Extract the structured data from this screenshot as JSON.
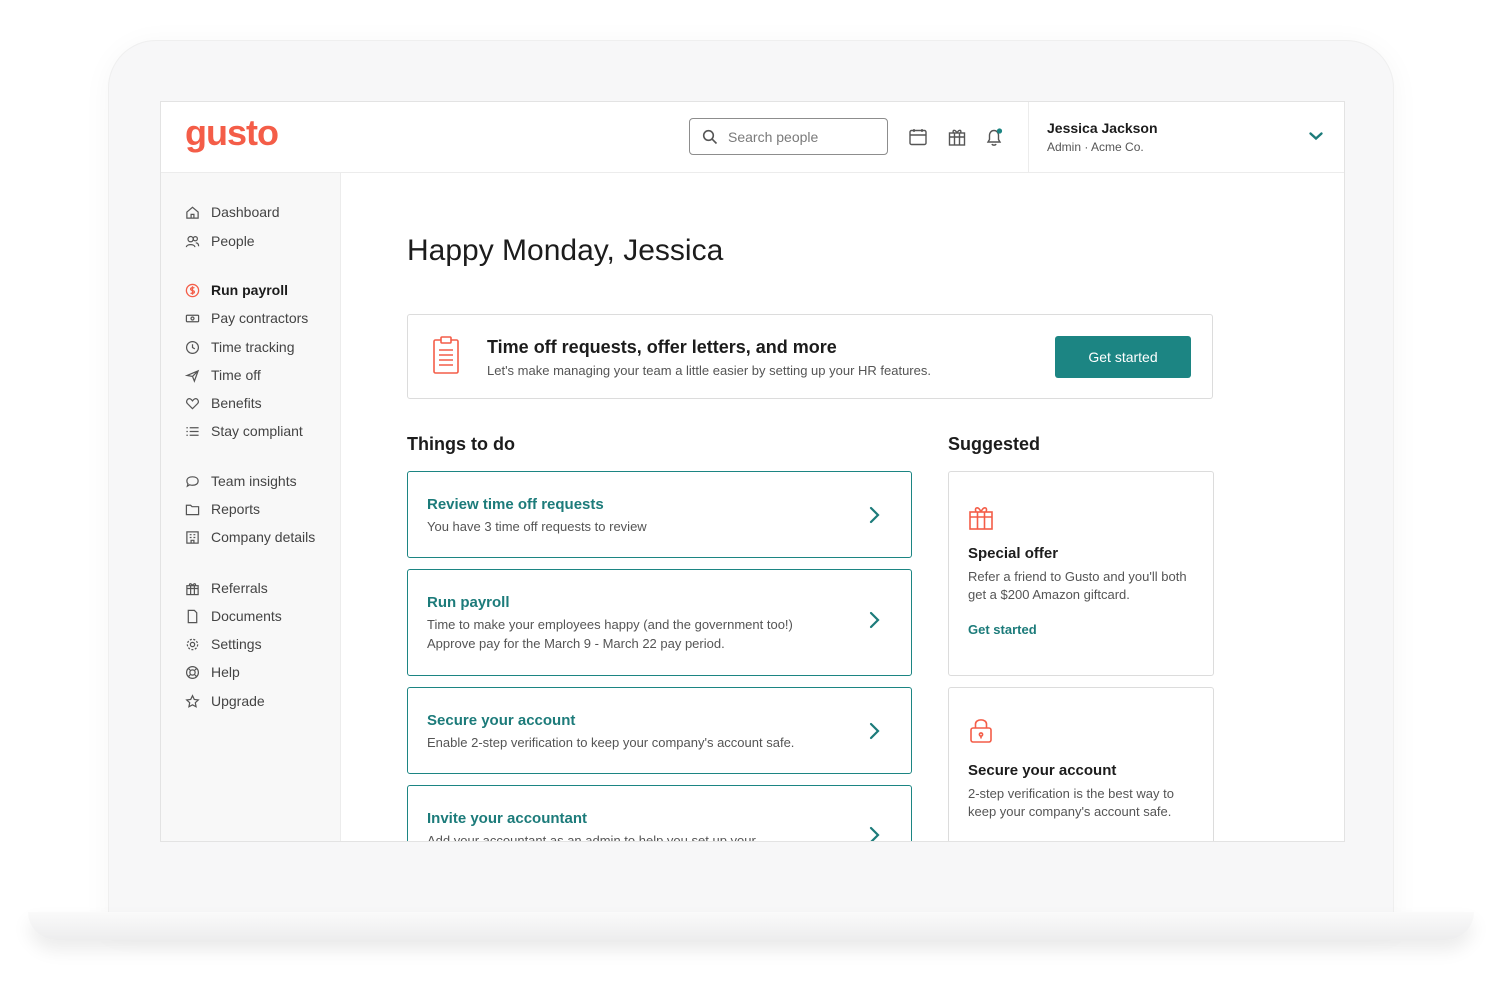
{
  "brand": {
    "logo_text": "gusto",
    "color": "#f45d48",
    "accent": "#1c8583"
  },
  "header": {
    "search_placeholder": "Search people",
    "icons": [
      "calendar-icon",
      "gift-icon",
      "bell-icon"
    ],
    "user": {
      "name": "Jessica Jackson",
      "role": "Admin · Acme Co."
    }
  },
  "sidebar": {
    "items": [
      {
        "label": "Dashboard",
        "icon": "home-icon"
      },
      {
        "label": "People",
        "icon": "people-icon"
      },
      {
        "label": "Run payroll",
        "icon": "dollar-icon",
        "active": true
      },
      {
        "label": "Pay contractors",
        "icon": "money-icon"
      },
      {
        "label": "Time tracking",
        "icon": "clock-icon"
      },
      {
        "label": "Time off",
        "icon": "plane-icon"
      },
      {
        "label": "Benefits",
        "icon": "heart-icon"
      },
      {
        "label": "Stay compliant",
        "icon": "list-icon"
      },
      {
        "label": "Team insights",
        "icon": "chat-icon"
      },
      {
        "label": "Reports",
        "icon": "folder-icon"
      },
      {
        "label": "Company details",
        "icon": "building-icon"
      },
      {
        "label": "Referrals",
        "icon": "gift-icon"
      },
      {
        "label": "Documents",
        "icon": "document-icon"
      },
      {
        "label": "Settings",
        "icon": "gear-icon"
      },
      {
        "label": "Help",
        "icon": "help-icon"
      },
      {
        "label": "Upgrade",
        "icon": "star-icon"
      }
    ]
  },
  "main": {
    "greeting": "Happy Monday, Jessica",
    "banner": {
      "title": "Time off requests, offer letters, and more",
      "subtitle": "Let's make managing your team a little easier by setting up your HR features.",
      "button": "Get started"
    },
    "todo": {
      "title": "Things to do",
      "items": [
        {
          "title": "Review time off requests",
          "desc": "You have 3 time off requests to review"
        },
        {
          "title": "Run payroll",
          "desc": "Time to make your employees happy (and the government too!) Approve pay for the March 9 - March 22 pay period."
        },
        {
          "title": "Secure your account",
          "desc": "Enable 2-step verification to keep your company's account safe."
        },
        {
          "title": "Invite your accountant",
          "desc": "Add your accountant as an admin to help you set up your"
        }
      ]
    },
    "suggested": {
      "title": "Suggested",
      "items": [
        {
          "title": "Special offer",
          "desc": "Refer a friend to Gusto and you'll both get a $200 Amazon giftcard.",
          "link": "Get started",
          "icon": "gift-icon"
        },
        {
          "title": "Secure your account",
          "desc": "2-step verification is the best way to keep your company's account safe.",
          "icon": "lock-icon"
        }
      ]
    }
  }
}
